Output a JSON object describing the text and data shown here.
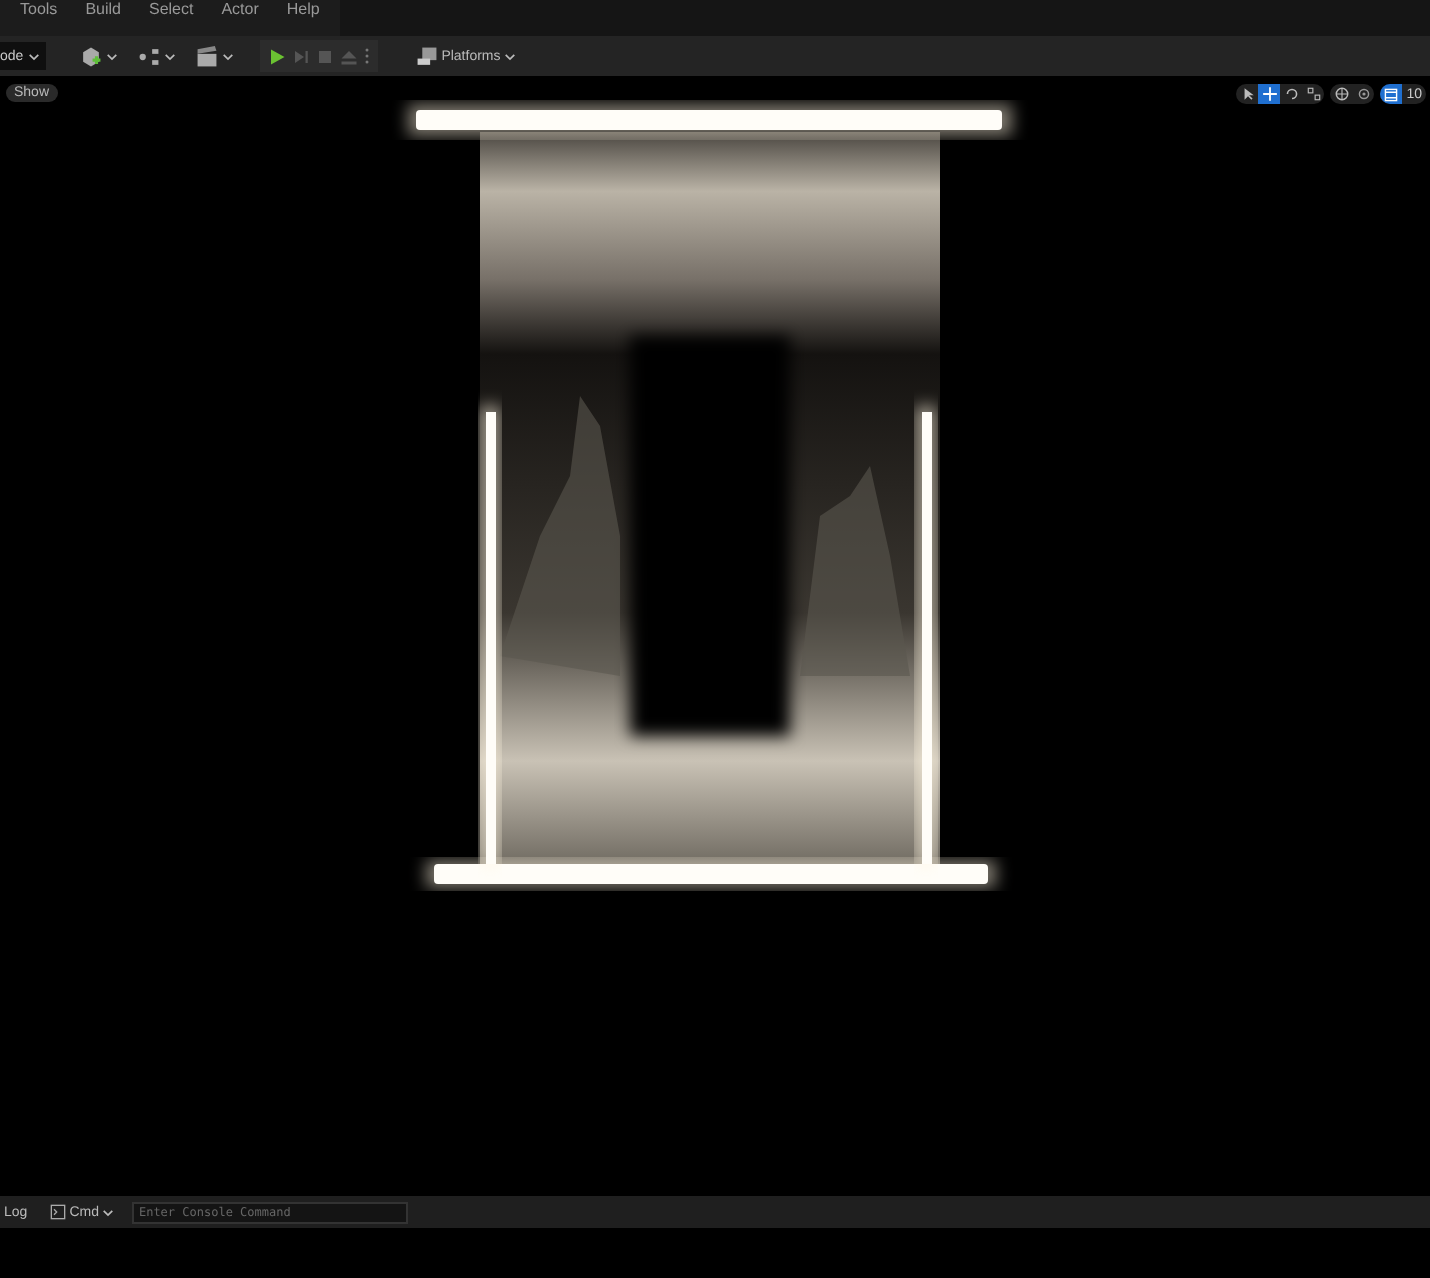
{
  "menu": [
    "Tools",
    "Build",
    "Select",
    "Actor",
    "Help"
  ],
  "toolbar": {
    "mode": "ode",
    "platforms": "Platforms"
  },
  "viewport": {
    "show": "Show",
    "tools": [
      {
        "kind": "select",
        "selected": false
      },
      {
        "kind": "move",
        "selected": true
      },
      {
        "kind": "rotate",
        "selected": false
      },
      {
        "kind": "scale",
        "selected": false
      }
    ],
    "grid_snap": {
      "on": true,
      "value": "10"
    }
  },
  "console": {
    "tab": "Log",
    "command_type": "Cmd",
    "placeholder": "Enter Console Command"
  }
}
